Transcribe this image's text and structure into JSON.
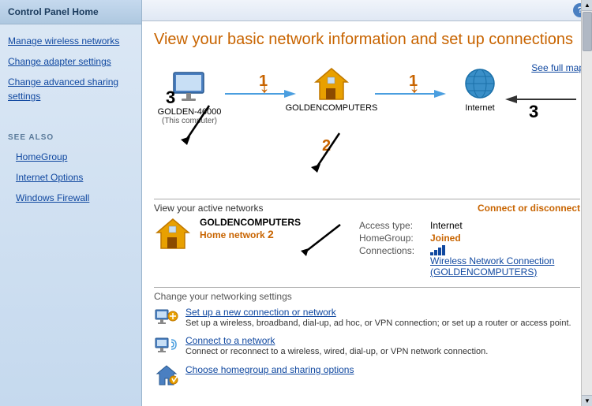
{
  "sidebar": {
    "header": "Control Panel Home",
    "links": [
      {
        "id": "manage-wireless",
        "label": "Manage wireless networks"
      },
      {
        "id": "change-adapter",
        "label": "Change adapter settings"
      },
      {
        "id": "change-advanced",
        "label": "Change advanced sharing settings"
      }
    ],
    "see_also_label": "See Also",
    "see_also_links": [
      {
        "id": "homegroup",
        "label": "HomeGroup"
      },
      {
        "id": "internet-options",
        "label": "Internet Options"
      },
      {
        "id": "windows-firewall",
        "label": "Windows Firewall"
      }
    ]
  },
  "toolbar": {
    "help_label": "?"
  },
  "page": {
    "title": "View your basic network information and set up connections",
    "see_full_map": "See full map"
  },
  "diagram": {
    "node_computer_label": "GOLDEN-46000",
    "node_computer_sublabel": "(This computer)",
    "node_router_label": "GOLDENCOMPUTERS",
    "node_internet_label": "Internet",
    "num1_left": "1",
    "num1_right": "1",
    "num2": "2",
    "num3_left": "3",
    "num3_right": "3"
  },
  "active_networks": {
    "section_label": "View your active networks",
    "connect_disconnect": "Connect or disconnect",
    "network_name": "GOLDENCOMPUTERS",
    "network_type": "Home network",
    "arrow_num": "2",
    "access_type_label": "Access type:",
    "access_type_value": "Internet",
    "homegroup_label": "HomeGroup:",
    "homegroup_value": "Joined",
    "connections_label": "Connections:",
    "connections_value": "Wireless Network Connection (GOLDENCOMPUTERS)"
  },
  "networking_settings": {
    "section_label": "Change your networking settings",
    "items": [
      {
        "id": "setup-connection",
        "title": "Set up a new connection or network",
        "desc": "Set up a wireless, broadband, dial-up, ad hoc, or VPN connection; or set up a router or access point."
      },
      {
        "id": "connect-network",
        "title": "Connect to a network",
        "desc": "Connect or reconnect to a wireless, wired, dial-up, or VPN network connection."
      },
      {
        "id": "homegroup-sharing",
        "title": "Choose homegroup and sharing options",
        "desc": ""
      }
    ]
  }
}
